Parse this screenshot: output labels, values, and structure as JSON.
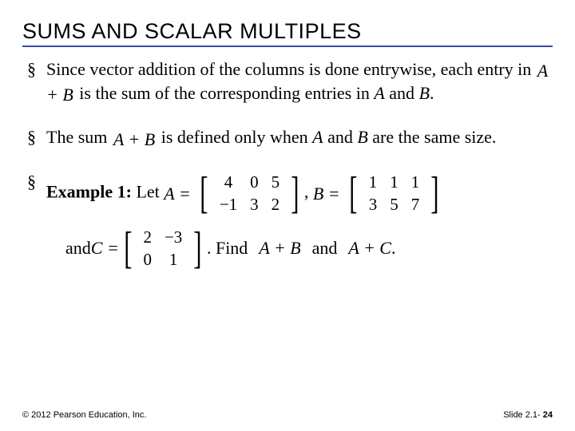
{
  "title": "SUMS AND SCALAR MULTIPLES",
  "bullets": {
    "b1a": "Since vector addition of the columns is done entrywise, each entry in ",
    "b1m": "A + B",
    "b1b": " is the sum of the corresponding entries in ",
    "b1A": "A",
    "b1and": " and ",
    "b1B": "B",
    "b1end": ".",
    "b2a": "The sum ",
    "b2m": "A + B",
    "b2b": " is defined only when ",
    "b2A": "A",
    "b2and": " and ",
    "b2B": "B",
    "b2c": " are the same size.",
    "b3a": "Example 1:",
    "b3b": " Let ",
    "eqA_lhs": "A =",
    "eqComma1": ",",
    "eqB_lhs": "B =",
    "sub_and1": "and ",
    "eqC_lhs": "C =",
    "sub_findPre": ". Find ",
    "sub_expr1": "A + B",
    "sub_and2": " and ",
    "sub_expr2": "A + C",
    "sub_end": "."
  },
  "matrices": {
    "A": [
      [
        "4",
        "0",
        "5"
      ],
      [
        "−1",
        "3",
        "2"
      ]
    ],
    "B": [
      [
        "1",
        "1",
        "1"
      ],
      [
        "3",
        "5",
        "7"
      ]
    ],
    "C": [
      [
        "2",
        "−3"
      ],
      [
        "0",
        "1"
      ]
    ]
  },
  "footer": {
    "left": "© 2012 Pearson Education, Inc.",
    "right_prefix": "Slide 2.1- ",
    "right_bold": "24"
  }
}
